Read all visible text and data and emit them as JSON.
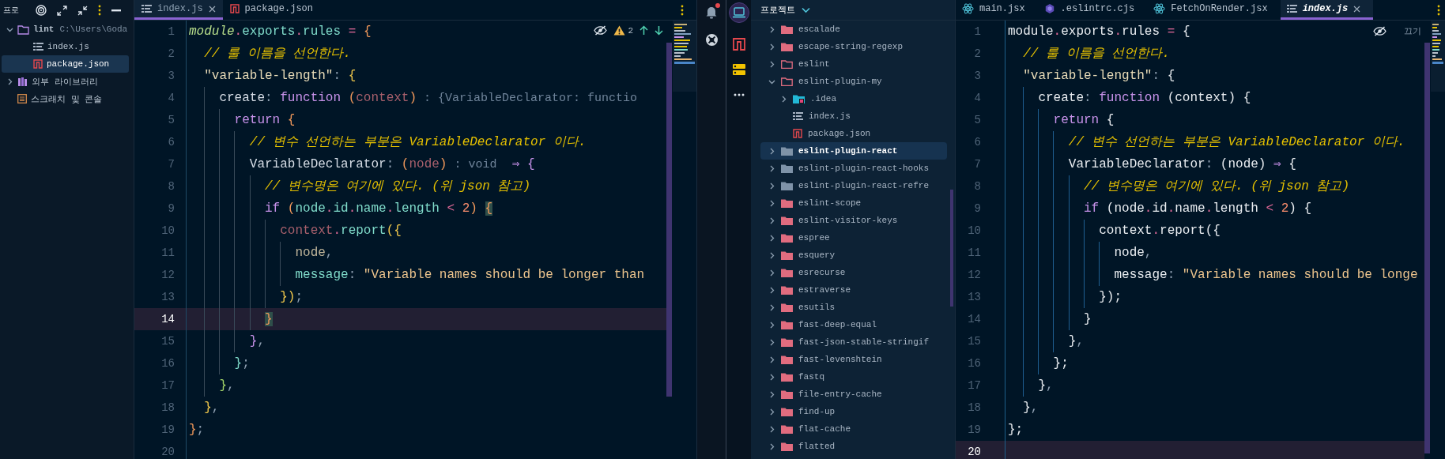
{
  "project_panel": {
    "title": "프로",
    "tree": [
      {
        "name": "lint",
        "path": "C:\\Users\\Goda",
        "kind": "folder",
        "selected": false,
        "expanded": true,
        "children": [
          {
            "name": "index.js",
            "kind": "js",
            "selected": false
          },
          {
            "name": "package.json",
            "kind": "json",
            "selected": true
          }
        ]
      },
      {
        "name": "외부 라이브러리",
        "kind": "library",
        "selected": false,
        "expanded": false
      },
      {
        "name": "스크래치 및 콘솔",
        "kind": "scratch",
        "selected": false
      }
    ]
  },
  "left_editor": {
    "tabs": [
      {
        "label": "index.js",
        "kind": "js",
        "selected": true,
        "closable": true
      },
      {
        "label": "package.json",
        "kind": "json",
        "selected": false,
        "closable": false
      }
    ],
    "warning_count": "2",
    "lines": [
      {
        "number": "1",
        "current": false,
        "tokens": [
          {
            "text": "module",
            "kind": "var"
          },
          {
            "text": ".",
            "kind": "op"
          },
          {
            "text": "exports",
            "kind": "prop"
          },
          {
            "text": ".",
            "kind": "op"
          },
          {
            "text": "rules",
            "kind": "prop"
          },
          {
            "text": " = ",
            "kind": "op"
          },
          {
            "text": "{",
            "kind": "b1"
          }
        ]
      },
      {
        "number": "2",
        "current": false,
        "tokens": [
          {
            "text": "  // 룰 이름을 선언한다.",
            "kind": "cmt"
          }
        ]
      },
      {
        "number": "3",
        "current": false,
        "tokens": [
          {
            "text": "  \"variable-length\"",
            "kind": "key"
          },
          {
            "text": ": ",
            "kind": "punc"
          },
          {
            "text": "{",
            "kind": "b2"
          }
        ]
      },
      {
        "number": "4",
        "current": false,
        "tokens": [
          {
            "text": "    create",
            "kind": "plain"
          },
          {
            "text": ": ",
            "kind": "punc"
          },
          {
            "text": "function ",
            "kind": "kw"
          },
          {
            "text": "(",
            "kind": "b1"
          },
          {
            "text": "context",
            "kind": "param"
          },
          {
            "text": ")",
            "kind": "b1"
          },
          {
            "text": " : {VariableDeclarator: functio",
            "kind": "hint"
          }
        ]
      },
      {
        "number": "5",
        "current": false,
        "tokens": [
          {
            "text": "      return ",
            "kind": "kw"
          },
          {
            "text": "{",
            "kind": "b1"
          }
        ]
      },
      {
        "number": "6",
        "current": false,
        "tokens": [
          {
            "text": "        // 변수 선언하는 부분은 VariableDeclarator 이다.",
            "kind": "cmt"
          }
        ]
      },
      {
        "number": "7",
        "current": false,
        "tokens": [
          {
            "text": "        VariableDeclarator",
            "kind": "plain"
          },
          {
            "text": ": ",
            "kind": "punc"
          },
          {
            "text": "(",
            "kind": "b1"
          },
          {
            "text": "node",
            "kind": "param"
          },
          {
            "text": ")",
            "kind": "b1"
          },
          {
            "text": " : void",
            "kind": "hint"
          },
          {
            "text": "  ⇒ ",
            "kind": "kw"
          },
          {
            "text": "{",
            "kind": "b3"
          }
        ]
      },
      {
        "number": "8",
        "current": false,
        "tokens": [
          {
            "text": "          // 변수명은 여기에 있다. (위 json 참고)",
            "kind": "cmt"
          }
        ]
      },
      {
        "number": "9",
        "current": false,
        "tokens": [
          {
            "text": "          if ",
            "kind": "kw"
          },
          {
            "text": "(",
            "kind": "b1"
          },
          {
            "text": "node",
            "kind": "prop"
          },
          {
            "text": ".",
            "kind": "op"
          },
          {
            "text": "id",
            "kind": "prop"
          },
          {
            "text": ".",
            "kind": "op"
          },
          {
            "text": "name",
            "kind": "prop"
          },
          {
            "text": ".",
            "kind": "op"
          },
          {
            "text": "length",
            "kind": "prop"
          },
          {
            "text": " < ",
            "kind": "op"
          },
          {
            "text": "2",
            "kind": "num"
          },
          {
            "text": ") ",
            "kind": "b1"
          },
          {
            "text": "{",
            "kind": "match"
          }
        ]
      },
      {
        "number": "10",
        "current": false,
        "tokens": [
          {
            "text": "            context",
            "kind": "param"
          },
          {
            "text": ".",
            "kind": "op"
          },
          {
            "text": "report",
            "kind": "prop"
          },
          {
            "text": "({",
            "kind": "b2"
          }
        ]
      },
      {
        "number": "11",
        "current": false,
        "tokens": [
          {
            "text": "              node",
            "kind": "short"
          },
          {
            "text": ",",
            "kind": "punc"
          }
        ]
      },
      {
        "number": "12",
        "current": false,
        "tokens": [
          {
            "text": "              message",
            "kind": "prop"
          },
          {
            "text": ": ",
            "kind": "punc"
          },
          {
            "text": "\"Variable names should be longer than",
            "kind": "str"
          }
        ]
      },
      {
        "number": "13",
        "current": false,
        "tokens": [
          {
            "text": "            })",
            "kind": "b2"
          },
          {
            "text": ";",
            "kind": "punc"
          }
        ]
      },
      {
        "number": "14",
        "current": true,
        "tokens": [
          {
            "text": "          }",
            "kind": "match"
          }
        ]
      },
      {
        "number": "15",
        "current": false,
        "tokens": [
          {
            "text": "        }",
            "kind": "b3"
          },
          {
            "text": ",",
            "kind": "punc"
          }
        ]
      },
      {
        "number": "16",
        "current": false,
        "tokens": [
          {
            "text": "      }",
            "kind": "b4"
          },
          {
            "text": ";",
            "kind": "punc"
          }
        ]
      },
      {
        "number": "17",
        "current": false,
        "tokens": [
          {
            "text": "    }",
            "kind": "b5"
          },
          {
            "text": ",",
            "kind": "punc"
          }
        ]
      },
      {
        "number": "18",
        "current": false,
        "tokens": [
          {
            "text": "  }",
            "kind": "b2"
          },
          {
            "text": ",",
            "kind": "punc"
          }
        ]
      },
      {
        "number": "19",
        "current": false,
        "tokens": [
          {
            "text": "}",
            "kind": "b1"
          },
          {
            "text": ";",
            "kind": "punc"
          }
        ]
      },
      {
        "number": "20",
        "current": false
      }
    ]
  },
  "notifications": {
    "unread": true
  },
  "tool_window_bar": {
    "items": [
      {
        "kind": "project",
        "selected": true
      },
      {
        "kind": "npm",
        "selected": false
      },
      {
        "kind": "database",
        "selected": false
      },
      {
        "kind": "more",
        "selected": false
      }
    ]
  },
  "project_tree": {
    "title": "프로젝트",
    "items": [
      {
        "name": "escalade",
        "kind": "folder",
        "selected": false,
        "expanded": false
      },
      {
        "name": "escape-string-regexp",
        "kind": "folder",
        "selected": false,
        "expanded": false
      },
      {
        "name": "eslint",
        "kind": "folder-outline",
        "selected": false,
        "expanded": false
      },
      {
        "name": "eslint-plugin-my",
        "kind": "folder-outline",
        "selected": false,
        "expanded": true,
        "children": [
          {
            "name": ".idea",
            "kind": "idea-folder",
            "selected": false,
            "expanded": false
          },
          {
            "name": "index.js",
            "kind": "js",
            "selected": false
          },
          {
            "name": "package.json",
            "kind": "json",
            "selected": false
          }
        ]
      },
      {
        "name": "eslint-plugin-react",
        "kind": "folder-gray",
        "selected": true,
        "expanded": false
      },
      {
        "name": "eslint-plugin-react-hooks",
        "kind": "folder-gray",
        "selected": false,
        "expanded": false
      },
      {
        "name": "eslint-plugin-react-refre",
        "kind": "folder-gray",
        "selected": false,
        "expanded": false
      },
      {
        "name": "eslint-scope",
        "kind": "folder",
        "selected": false,
        "expanded": false
      },
      {
        "name": "eslint-visitor-keys",
        "kind": "folder",
        "selected": false,
        "expanded": false
      },
      {
        "name": "espree",
        "kind": "folder",
        "selected": false,
        "expanded": false
      },
      {
        "name": "esquery",
        "kind": "folder",
        "selected": false,
        "expanded": false
      },
      {
        "name": "esrecurse",
        "kind": "folder",
        "selected": false,
        "expanded": false
      },
      {
        "name": "estraverse",
        "kind": "folder",
        "selected": false,
        "expanded": false
      },
      {
        "name": "esutils",
        "kind": "folder",
        "selected": false,
        "expanded": false
      },
      {
        "name": "fast-deep-equal",
        "kind": "folder",
        "selected": false,
        "expanded": false
      },
      {
        "name": "fast-json-stable-stringif",
        "kind": "folder",
        "selected": false,
        "expanded": false
      },
      {
        "name": "fast-levenshtein",
        "kind": "folder",
        "selected": false,
        "expanded": false
      },
      {
        "name": "fastq",
        "kind": "folder",
        "selected": false,
        "expanded": false
      },
      {
        "name": "file-entry-cache",
        "kind": "folder",
        "selected": false,
        "expanded": false
      },
      {
        "name": "find-up",
        "kind": "folder",
        "selected": false,
        "expanded": false
      },
      {
        "name": "flat-cache",
        "kind": "folder",
        "selected": false,
        "expanded": false
      },
      {
        "name": "flatted",
        "kind": "folder",
        "selected": false,
        "expanded": false
      }
    ]
  },
  "right_editor": {
    "tabs": [
      {
        "label": "main.jsx",
        "kind": "react",
        "selected": false,
        "closable": false
      },
      {
        "label": ".eslintrc.cjs",
        "kind": "eslint",
        "selected": false,
        "closable": false
      },
      {
        "label": "FetchOnRender.jsx",
        "kind": "react",
        "selected": false,
        "closable": false
      },
      {
        "label": "index.js",
        "kind": "js",
        "selected": true,
        "closable": true
      }
    ],
    "reader_mode_label": "끄기",
    "lines": [
      {
        "number": "1",
        "current": false,
        "tokens": [
          {
            "text": "module",
            "kind": "plain"
          },
          {
            "text": ".",
            "kind": "op"
          },
          {
            "text": "exports",
            "kind": "plain"
          },
          {
            "text": ".",
            "kind": "op"
          },
          {
            "text": "rules",
            "kind": "plain"
          },
          {
            "text": " = ",
            "kind": "op"
          },
          {
            "text": "{",
            "kind": "plain"
          }
        ]
      },
      {
        "number": "2",
        "current": false,
        "tokens": [
          {
            "text": "  // 룰 이름을 선언한다.",
            "kind": "cmt"
          }
        ]
      },
      {
        "number": "3",
        "current": false,
        "tokens": [
          {
            "text": "  \"variable-length\"",
            "kind": "key"
          },
          {
            "text": ": ",
            "kind": "punc"
          },
          {
            "text": "{",
            "kind": "plain"
          }
        ]
      },
      {
        "number": "4",
        "current": false,
        "tokens": [
          {
            "text": "    create",
            "kind": "plain"
          },
          {
            "text": ": ",
            "kind": "punc"
          },
          {
            "text": "function",
            "kind": "kw"
          },
          {
            "text": " (context) {",
            "kind": "plain"
          }
        ]
      },
      {
        "number": "5",
        "current": false,
        "tokens": [
          {
            "text": "      return",
            "kind": "kw"
          },
          {
            "text": " {",
            "kind": "plain"
          }
        ]
      },
      {
        "number": "6",
        "current": false,
        "tokens": [
          {
            "text": "        // 변수 선언하는 부분은 VariableDeclarator 이다.",
            "kind": "cmt"
          }
        ]
      },
      {
        "number": "7",
        "current": false,
        "tokens": [
          {
            "text": "        VariableDeclarator",
            "kind": "plain"
          },
          {
            "text": ": ",
            "kind": "punc"
          },
          {
            "text": "(node) ",
            "kind": "plain"
          },
          {
            "text": "⇒",
            "kind": "kw"
          },
          {
            "text": " {",
            "kind": "plain"
          }
        ]
      },
      {
        "number": "8",
        "current": false,
        "tokens": [
          {
            "text": "          // 변수명은 여기에 있다. (위 json 참고)",
            "kind": "cmt"
          }
        ]
      },
      {
        "number": "9",
        "current": false,
        "tokens": [
          {
            "text": "          if",
            "kind": "kw"
          },
          {
            "text": " (node",
            "kind": "plain"
          },
          {
            "text": ".",
            "kind": "op"
          },
          {
            "text": "id",
            "kind": "plain"
          },
          {
            "text": ".",
            "kind": "op"
          },
          {
            "text": "name",
            "kind": "plain"
          },
          {
            "text": ".",
            "kind": "op"
          },
          {
            "text": "length",
            "kind": "plain"
          },
          {
            "text": " < ",
            "kind": "op"
          },
          {
            "text": "2",
            "kind": "num"
          },
          {
            "text": ") {",
            "kind": "plain"
          }
        ]
      },
      {
        "number": "10",
        "current": false,
        "tokens": [
          {
            "text": "            context",
            "kind": "plain"
          },
          {
            "text": ".",
            "kind": "op"
          },
          {
            "text": "report({",
            "kind": "plain"
          }
        ]
      },
      {
        "number": "11",
        "current": false,
        "tokens": [
          {
            "text": "              node",
            "kind": "plain"
          },
          {
            "text": ",",
            "kind": "punc"
          }
        ]
      },
      {
        "number": "12",
        "current": false,
        "tokens": [
          {
            "text": "              message",
            "kind": "plain"
          },
          {
            "text": ": ",
            "kind": "punc"
          },
          {
            "text": "\"Variable names should be longe",
            "kind": "str"
          }
        ]
      },
      {
        "number": "13",
        "current": false,
        "tokens": [
          {
            "text": "            });",
            "kind": "plain"
          }
        ]
      },
      {
        "number": "14",
        "current": false,
        "tokens": [
          {
            "text": "          }",
            "kind": "plain"
          }
        ]
      },
      {
        "number": "15",
        "current": false,
        "tokens": [
          {
            "text": "        }",
            "kind": "plain"
          },
          {
            "text": ",",
            "kind": "punc"
          }
        ]
      },
      {
        "number": "16",
        "current": false,
        "tokens": [
          {
            "text": "      };",
            "kind": "plain"
          }
        ]
      },
      {
        "number": "17",
        "current": false,
        "tokens": [
          {
            "text": "    }",
            "kind": "plain"
          },
          {
            "text": ",",
            "kind": "punc"
          }
        ]
      },
      {
        "number": "18",
        "current": false,
        "tokens": [
          {
            "text": "  }",
            "kind": "plain"
          },
          {
            "text": ",",
            "kind": "punc"
          }
        ]
      },
      {
        "number": "19",
        "current": false,
        "tokens": [
          {
            "text": "};",
            "kind": "plain"
          }
        ]
      },
      {
        "number": "20",
        "current": true
      }
    ]
  }
}
